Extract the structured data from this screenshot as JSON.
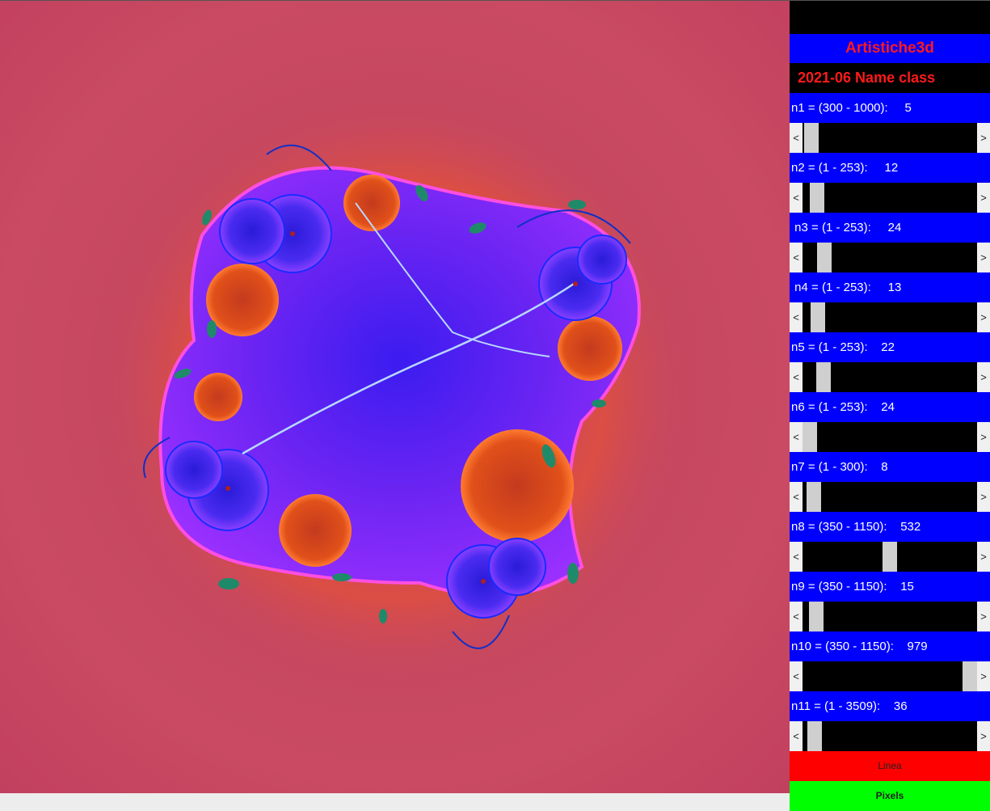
{
  "header": {
    "title": "Artistiche3d",
    "subtitle": "2021-06  Name class"
  },
  "params": [
    {
      "label": "n1 = (300 - 1000):     5",
      "fraction": 0.01
    },
    {
      "label": "n2 = (1 - 253):     12",
      "fraction": 0.045
    },
    {
      "label": " n3 = (1 - 253):     24",
      "fraction": 0.09
    },
    {
      "label": " n4 = (1 - 253):     13",
      "fraction": 0.05
    },
    {
      "label": "n5 = (1 - 253):    22",
      "fraction": 0.085
    },
    {
      "label": "n6 = (1 - 253):    24",
      "fraction": 0.0
    },
    {
      "label": "n7 = (1 - 300):    8",
      "fraction": 0.025
    },
    {
      "label": "n8 = (350 - 1150):    532",
      "fraction": 0.5
    },
    {
      "label": "n9 = (350 - 1150):    15",
      "fraction": 0.04
    },
    {
      "label": "n10 = (350 - 1150):    979",
      "fraction": 1.0
    },
    {
      "label": "n11 = (1 - 3509):    36",
      "fraction": 0.03
    }
  ],
  "arrows": {
    "left": "<",
    "right": ">"
  },
  "buttons": {
    "linea": "Linea",
    "pixels": "Pixels"
  },
  "colors": {
    "panel_blue": "#0000ff",
    "title_red": "#ff1a1a",
    "linea": "#ff0000",
    "pixels": "#00ff00"
  }
}
